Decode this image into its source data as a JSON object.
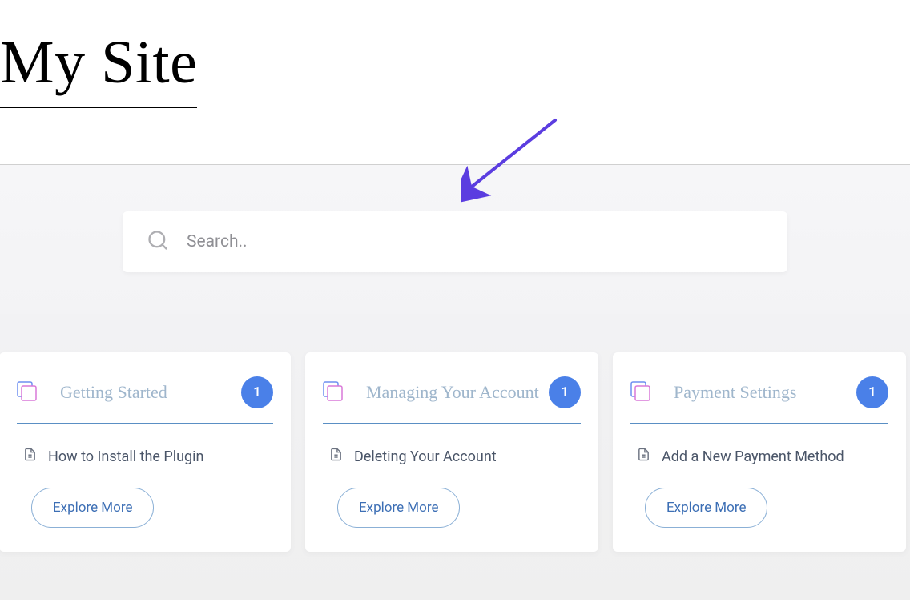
{
  "site": {
    "title": "My Site"
  },
  "search": {
    "placeholder": "Search.."
  },
  "cards": [
    {
      "title": "Getting Started",
      "count": "1",
      "article": "How to Install the Plugin",
      "explore": "Explore More"
    },
    {
      "title": "Managing Your Account",
      "count": "1",
      "article": "Deleting Your Account",
      "explore": "Explore More"
    },
    {
      "title": "Payment Settings",
      "count": "1",
      "article": "Add a New Payment Method",
      "explore": "Explore More"
    }
  ]
}
